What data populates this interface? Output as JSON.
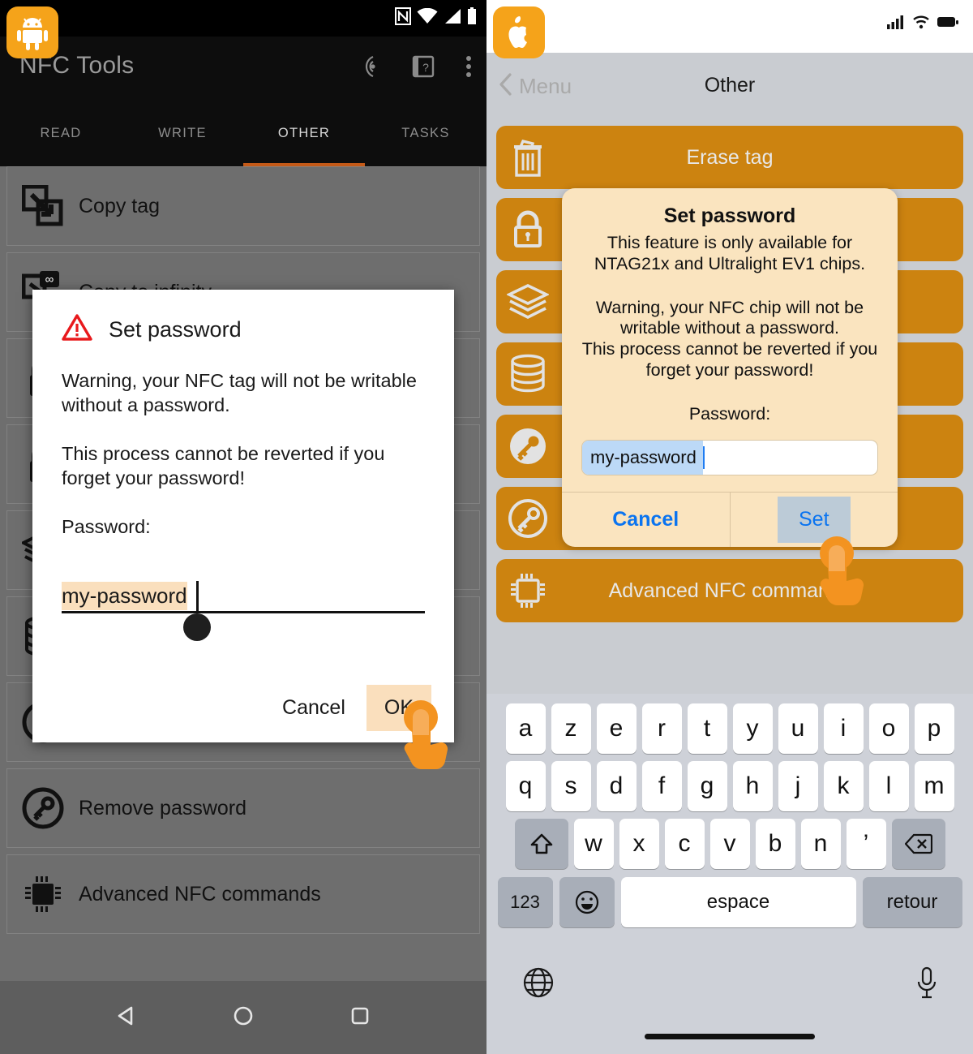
{
  "android": {
    "app_logo_icon": "android-robot-icon",
    "status_icons": [
      "nfc-icon",
      "wifi-icon",
      "signal-icon",
      "battery-icon"
    ],
    "title": "NFC Tools",
    "toolbar_icons": [
      "nfc-scan-icon",
      "help-book-icon",
      "overflow-menu-icon"
    ],
    "tabs": [
      {
        "label": "READ",
        "active": false
      },
      {
        "label": "WRITE",
        "active": false
      },
      {
        "label": "OTHER",
        "active": true
      },
      {
        "label": "TASKS",
        "active": false
      }
    ],
    "list": [
      {
        "label": "Copy tag",
        "icon": "copy-tag-icon"
      },
      {
        "label": "Copy to infinity",
        "icon": "copy-infinity-icon"
      },
      {
        "label": "",
        "icon": "lock-icon"
      },
      {
        "label": "",
        "icon": "lock-icon"
      },
      {
        "label": "",
        "icon": "layers-icon"
      },
      {
        "label": "",
        "icon": "database-icon"
      },
      {
        "label": "",
        "icon": "key-circle-icon"
      },
      {
        "label": "Remove password",
        "icon": "key-circle-icon"
      },
      {
        "label": "Advanced NFC commands",
        "icon": "chip-icon"
      }
    ],
    "dialog": {
      "warning_icon": "warning-triangle-icon",
      "title": "Set password",
      "paragraphs": [
        "Warning, your NFC tag will not be writable without a password.",
        "This process cannot be reverted if you forget your password!",
        "Password:"
      ],
      "input_value": "my-password",
      "cancel_label": "Cancel",
      "ok_label": "OK"
    },
    "navbar": [
      "back-triangle-icon",
      "home-circle-icon",
      "recents-square-icon"
    ],
    "accent_color": "#c45a18",
    "brand_color": "#f5a31a"
  },
  "ios": {
    "app_logo_icon": "apple-logo-icon",
    "status_icons": [
      "cellular-signal-icon",
      "wifi-icon",
      "battery-icon"
    ],
    "back_label": "Menu",
    "nav_title": "Other",
    "buttons": [
      {
        "label": "Erase tag",
        "icon": "trash-icon"
      },
      {
        "label": "",
        "icon": "lock-icon"
      },
      {
        "label": "",
        "icon": "layers-icon"
      },
      {
        "label": "",
        "icon": "database-icon"
      },
      {
        "label": "",
        "icon": "key-circle-icon"
      },
      {
        "label": "",
        "icon": "key-circle-icon"
      },
      {
        "label": "Advanced NFC commands",
        "icon": "chip-icon"
      }
    ],
    "dialog": {
      "title": "Set password",
      "subtitle": "This feature is only available for NTAG21x and Ultralight EV1 chips.",
      "warning_line1": "Warning, your NFC chip will not be writable without a password.",
      "warning_line2": "This process cannot be reverted if you forget your password!",
      "password_label": "Password:",
      "input_value": "my-password",
      "cancel_label": "Cancel",
      "set_label": "Set"
    },
    "keyboard": {
      "row1": [
        "a",
        "z",
        "e",
        "r",
        "t",
        "y",
        "u",
        "i",
        "o",
        "p"
      ],
      "row2": [
        "q",
        "s",
        "d",
        "f",
        "g",
        "h",
        "j",
        "k",
        "l",
        "m"
      ],
      "row3": [
        "w",
        "x",
        "c",
        "v",
        "b",
        "n",
        "’"
      ],
      "shift_icon": "shift-up-icon",
      "backspace_icon": "backspace-icon",
      "numbers_label": "123",
      "emoji_icon": "emoji-smiley-icon",
      "space_label": "espace",
      "return_label": "retour",
      "globe_icon": "globe-icon",
      "mic_icon": "microphone-icon"
    },
    "button_color": "#cc8310",
    "dialog_bg": "#fae4bf",
    "link_color": "#0a74f0"
  }
}
